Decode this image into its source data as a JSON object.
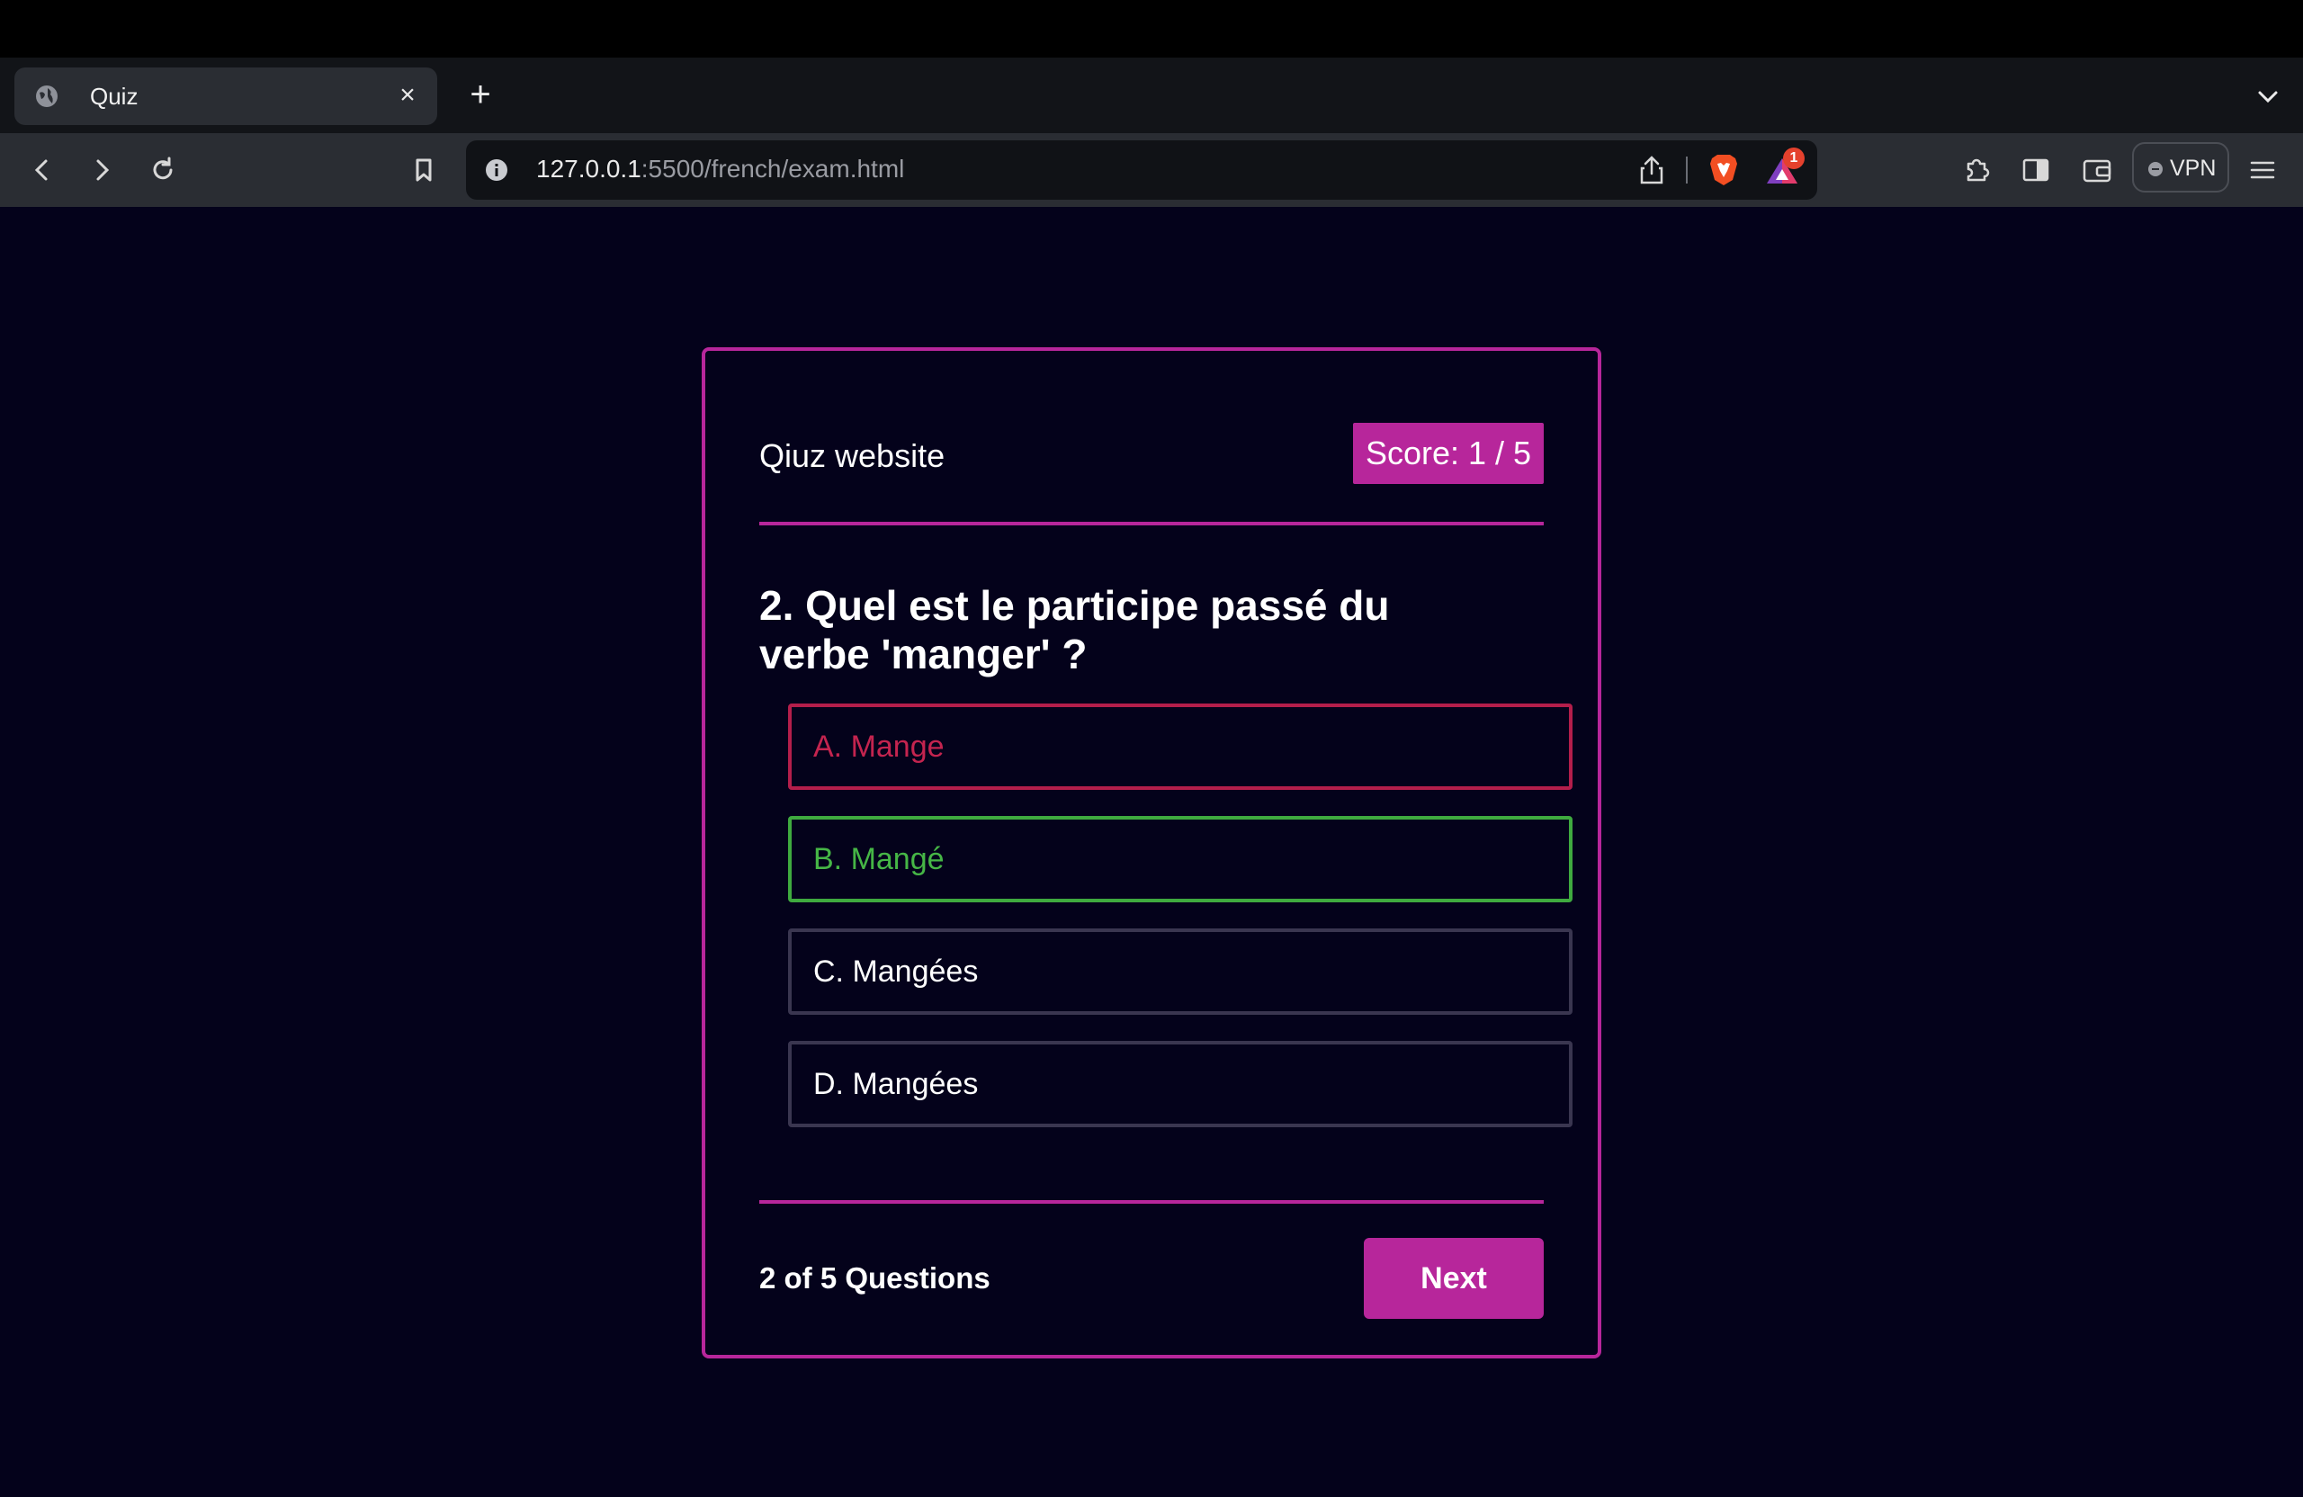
{
  "browser": {
    "tab_title": "Quiz",
    "url_host": "127.0.0.1",
    "url_rest": ":5500/french/exam.html",
    "rewards_badge": "1",
    "vpn_label": "VPN"
  },
  "quiz": {
    "title": "Qiuz website",
    "score": "Score: 1 / 5",
    "question": "2. Quel est le participe passé du verbe 'manger' ?",
    "options": [
      {
        "label": "A. Mange",
        "state": "wrong"
      },
      {
        "label": "B. Mangé",
        "state": "correct"
      },
      {
        "label": "C. Mangées",
        "state": "neutral"
      },
      {
        "label": "D. Mangées",
        "state": "neutral"
      }
    ],
    "progress": "2 of 5 Questions",
    "next_label": "Next"
  },
  "colors": {
    "accent": "#b7269b",
    "background": "#04021b",
    "wrong": "#c4244f",
    "correct": "#46b646"
  }
}
